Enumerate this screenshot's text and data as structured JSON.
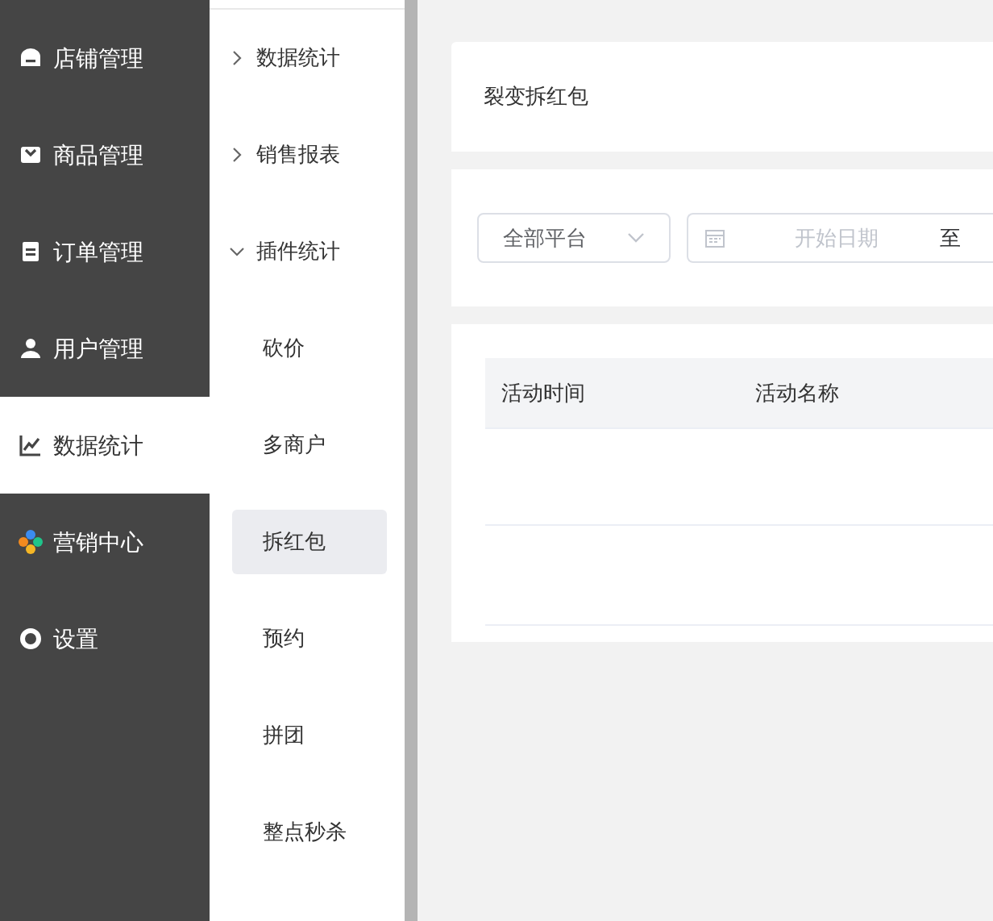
{
  "sidebar": {
    "items": [
      {
        "label": "店铺管理",
        "selected": false
      },
      {
        "label": "商品管理",
        "selected": false
      },
      {
        "label": "订单管理",
        "selected": false
      },
      {
        "label": "用户管理",
        "selected": false
      },
      {
        "label": "数据统计",
        "selected": true
      },
      {
        "label": "营销中心",
        "selected": false
      },
      {
        "label": "设置",
        "selected": false
      }
    ]
  },
  "submenu": {
    "groups": [
      {
        "label": "数据统计",
        "expanded": false
      },
      {
        "label": "销售报表",
        "expanded": false
      },
      {
        "label": "插件统计",
        "expanded": true,
        "children": [
          {
            "label": "砍价",
            "selected": false
          },
          {
            "label": "多商户",
            "selected": false
          },
          {
            "label": "拆红包",
            "selected": true
          },
          {
            "label": "预约",
            "selected": false
          },
          {
            "label": "拼团",
            "selected": false
          },
          {
            "label": "整点秒杀",
            "selected": false
          }
        ]
      }
    ]
  },
  "page_title": "裂变拆红包",
  "filters": {
    "platform": {
      "value": "全部平台"
    },
    "date_range": {
      "start_placeholder": "开始日期",
      "separator": "至"
    }
  },
  "table": {
    "columns": [
      "活动时间",
      "活动名称"
    ]
  }
}
